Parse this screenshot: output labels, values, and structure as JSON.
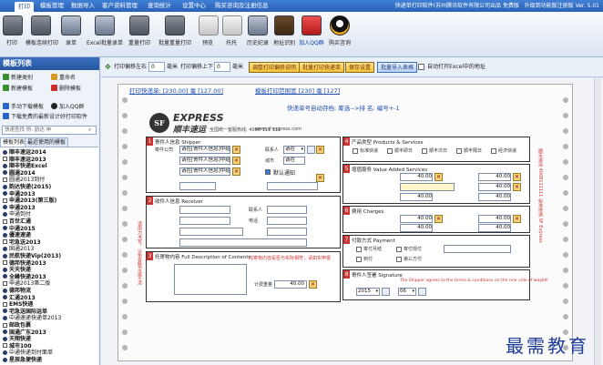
{
  "menubar": {
    "items": [
      "打印",
      "模板管理",
      "数据导入",
      "客户资料管理",
      "查询统计",
      "设置中心",
      "购买咨询及注册信息"
    ],
    "active_index": 0,
    "title": "快递单打印软件(苏州腾讯软件有限公司出品 免费版",
    "version": "升级到功能版注册版 Ver. 5.01"
  },
  "toolbar": {
    "buttons": [
      "打印",
      "模板连续打印",
      "录单",
      "Excel批量录单",
      "重量打印",
      "批量重量打印",
      "预览",
      "托托",
      "历史纪录",
      "地址识别",
      "加入QQ群",
      "购买咨询"
    ]
  },
  "left_panel": {
    "title": "模板列表",
    "actions": {
      "new_type": "新建类别",
      "rename": "重命名",
      "new_template": "新建模板",
      "delete_template": "删除模板",
      "manual_download": "手动下载模板",
      "join_qq": "加入QQ群",
      "download_latest": "下载免费的最新设计好打印软件"
    },
    "search_placeholder": "快速查找 例: 韵达 申",
    "tabs": [
      "模板列表",
      "最近使用的模板"
    ],
    "templates": [
      "顺丰速运2014",
      "顺丰速运2013",
      "顺丰快递Excel",
      "圆通2014",
      "圆通2013到付",
      "韵达快递(2015)",
      "申通2013",
      "申通2013(第三版)",
      "申通2013",
      "申通到付",
      "百世汇通",
      "中通2015",
      "優速速递",
      "宅急送2013",
      "国通2013",
      "民航快递Vip(2013)",
      "德邦快递2013",
      "天天快递",
      "全峰快递2013",
      "申通2013第二版",
      "德邦物流",
      "汇通2013",
      "EMS快递",
      "宅急送国际运单",
      "中通速递快递单2013",
      "邮政包裹",
      "国通广东2013",
      "天翔快递",
      "城市100",
      "中通快递到付面单",
      "星辰急便快递"
    ]
  },
  "controls": {
    "print_offset_lr": "打印偏移左右",
    "print_offset_lr_value": "0",
    "unit_mm": "毫米",
    "print_offset_ud": "打印偏移上下",
    "print_offset_ud_value": "0",
    "unit_mm_2": "毫米",
    "btn_adjust_offset": "调整打印偏移说明",
    "btn_batch_print": "批量打印快递单",
    "btn_save": "保存设置",
    "btn_batch_import": "批量导入表格",
    "auto_open_excel": "自动打开Excel中的地址"
  },
  "form": {
    "print_count_line": "打印快递单: [230.00] 毫 [127.00]",
    "template_size_line": "模板打印范围宽 [230] 毫 [127]",
    "number_line": "快递单号自动存档: 筹选-->排 名: 编号+-1",
    "brand_en": "EXPRESS",
    "brand_cn": "顺丰速运",
    "logo_text": "SF",
    "hotline": "全国统一客服热线: 4008 111 111",
    "website": "www.sf-express.com",
    "sender": {
      "num": "1",
      "header": "寄件人信息 Shipper",
      "name_label": "寄件公司",
      "company": "请在[寄件人信息]中给",
      "addr1": "请在[寄件人信息]中给",
      "addr2": "请在[寄件人信息]中给",
      "contact_label": "联系人",
      "contact_value": "请在",
      "city_label": "城市",
      "city_value": "请在",
      "checkbox": "默认通知"
    },
    "receiver": {
      "num": "2",
      "header": "收件人信息 Receiver",
      "tel_label": "电话",
      "contact_label": "联系人"
    },
    "contents": {
      "num": "3",
      "header": "托寄物内容 Full Description of Contents",
      "note": "托寄物内容是否与实际相符，请如实申报"
    },
    "product": {
      "num": "4",
      "header": "产品类型 Products & Services",
      "opts": [
        "标准快递",
        "顺丰即日",
        "顺丰次日",
        "顺丰隔日",
        "经济快递"
      ]
    },
    "value_added": {
      "num": "5",
      "header": "增值服务 Value Added Services",
      "v1": "40.00",
      "v2": "40.00",
      "v3": "40.00",
      "v4": "40.00",
      "v5": "40.00"
    },
    "charges": {
      "num": "6",
      "header": "费用 Charges",
      "v1": "40.00",
      "v2": "40.00",
      "v3": "40.00",
      "v4": "40.00"
    },
    "payment": {
      "num": "7",
      "header": "付款方式 Payment",
      "opts": [
        "寄付月结",
        "寄付现付",
        "到付",
        "第三方付"
      ]
    },
    "signature": {
      "num": "8",
      "header": "寄件人签署 Signature",
      "note": "The Shipper agrees to the terms & conditions on the rear side of waybill",
      "year": "2015",
      "month": "06"
    },
    "weight_label": "计费重量",
    "weight_value": "40.00",
    "side_text": "顺丰速运 4008111111 标准快递 SF Express",
    "red_side": "请用力书写，以免各联字迹不清"
  },
  "watermark": "最需教育"
}
